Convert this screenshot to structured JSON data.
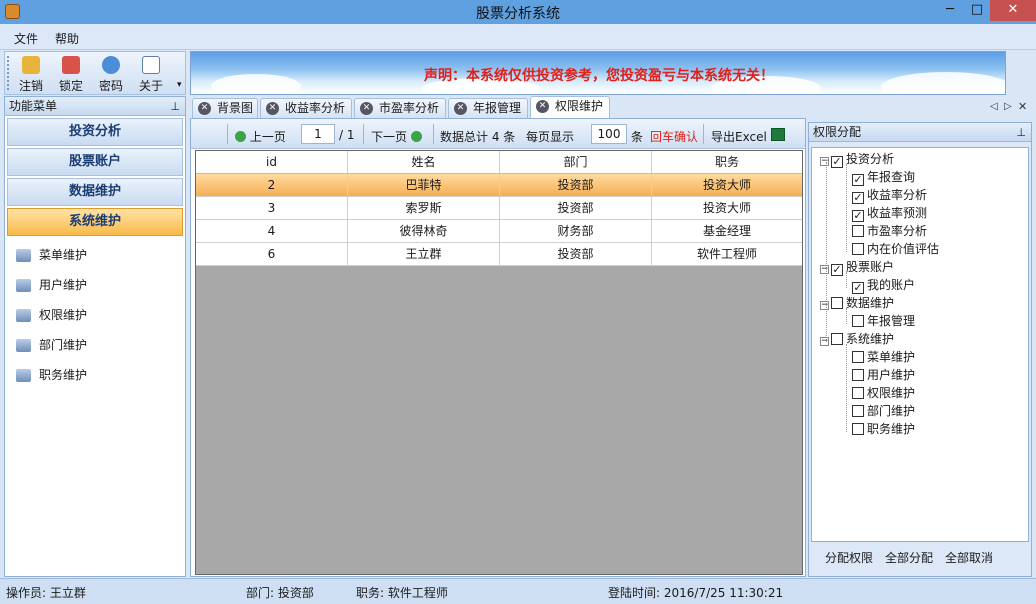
{
  "window": {
    "title": "股票分析系统",
    "minimize": "─",
    "maximize": "□",
    "close": "✕"
  },
  "menu": {
    "items": [
      "文件",
      "帮助"
    ]
  },
  "toolbar": {
    "buttons": [
      "注销",
      "锁定",
      "密码",
      "关于"
    ]
  },
  "banner": {
    "notice": "声明：本系统仅供投资参考，您投资盈亏与本系统无关！"
  },
  "left_panel": {
    "title": "功能菜单",
    "categories": [
      "投资分析",
      "股票账户",
      "数据维护",
      "系统维护"
    ],
    "active_category": "系统维护",
    "sub_items": [
      "菜单维护",
      "用户维护",
      "权限维护",
      "部门维护",
      "职务维护"
    ]
  },
  "tabs": {
    "items": [
      "背景图",
      "收益率分析",
      "市盈率分析",
      "年报管理",
      "权限维护"
    ],
    "active": "权限维护"
  },
  "pager": {
    "prev": "上一页",
    "page": "1",
    "of": "/ 1",
    "next": "下一页",
    "total": "数据总计 4 条",
    "per_page_label": "每页显示",
    "per_page": "100",
    "unit": "条",
    "confirm": "回车确认",
    "export": "导出Excel"
  },
  "grid": {
    "columns": [
      "id",
      "姓名",
      "部门",
      "职务"
    ],
    "rows": [
      [
        "2",
        "巴菲特",
        "投资部",
        "投资大师"
      ],
      [
        "3",
        "索罗斯",
        "投资部",
        "投资大师"
      ],
      [
        "4",
        "彼得林奇",
        "财务部",
        "基金经理"
      ],
      [
        "6",
        "王立群",
        "投资部",
        "软件工程师"
      ]
    ]
  },
  "right_panel": {
    "title": "权限分配",
    "tree": [
      {
        "label": "投资分析",
        "checked": true,
        "children": [
          {
            "label": "年报查询",
            "checked": true
          },
          {
            "label": "收益率分析",
            "checked": true
          },
          {
            "label": "收益率预测",
            "checked": true
          },
          {
            "label": "市盈率分析",
            "checked": false
          },
          {
            "label": "内在价值评估",
            "checked": false
          }
        ]
      },
      {
        "label": "股票账户",
        "checked": true,
        "children": [
          {
            "label": "我的账户",
            "checked": true
          }
        ]
      },
      {
        "label": "数据维护",
        "checked": false,
        "children": [
          {
            "label": "年报管理",
            "checked": false
          }
        ]
      },
      {
        "label": "系统维护",
        "checked": false,
        "children": [
          {
            "label": "菜单维护",
            "checked": false
          },
          {
            "label": "用户维护",
            "checked": false
          },
          {
            "label": "权限维护",
            "checked": false
          },
          {
            "label": "部门维护",
            "checked": false
          },
          {
            "label": "职务维护",
            "checked": false
          }
        ]
      }
    ],
    "buttons": [
      "分配权限",
      "全部分配",
      "全部取消"
    ]
  },
  "status": {
    "operator": "操作员:  王立群",
    "department": "部门:  投资部",
    "position": "职务:  软件工程师",
    "login_time": "登陆时间:  2016/7/25 11:30:21"
  }
}
